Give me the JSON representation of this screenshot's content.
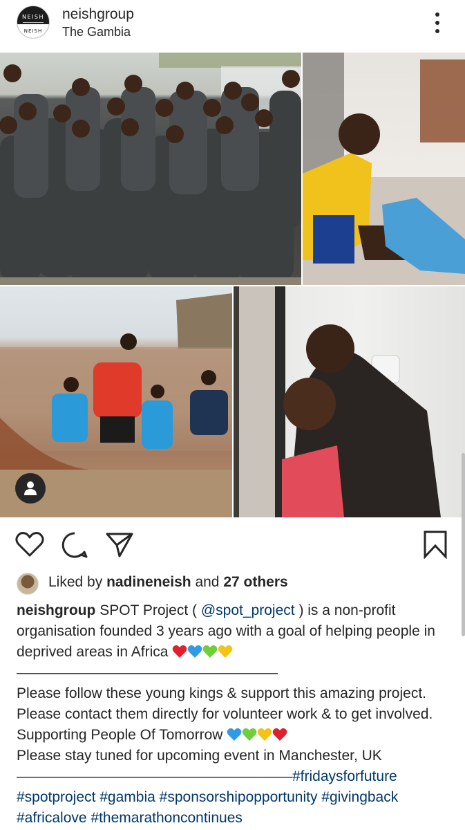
{
  "post": {
    "username": "neishgroup",
    "location": "The Gambia",
    "avatar_logo": {
      "top": "NEISH",
      "bottom": "NEISH"
    }
  },
  "icons": {
    "more": "more-vertical-icon",
    "like": "heart-outline-icon",
    "comment": "comment-bubble-icon",
    "share": "paper-plane-icon",
    "save": "bookmark-icon",
    "tag": "user-tag-icon"
  },
  "likes": {
    "prefix": "Liked by",
    "user": "nadineneish",
    "middle": "and",
    "others": "27 others"
  },
  "caption": {
    "username": "neishgroup",
    "line1_a": "SPOT Project (",
    "mention": "@spot_project",
    "line1_b": ") is a non-profit organisation founded 3 years ago with a goal of helping people in deprived areas in Africa",
    "divider1": "——————————————————",
    "para2": "Please follow these young kings & support this amazing project. Please contact them directly for volunteer work & to get involved. Supporting People Of Tomorrow",
    "para3": "Please stay tuned for upcoming event in Manchester, UK",
    "divider2": "———————————————————",
    "hashtags": [
      "#fridaysforfuture",
      "#spotproject",
      "#gambia",
      "#sponsorshipopportunity",
      "#givingback",
      "#africalove",
      "#themarathoncontinues"
    ]
  },
  "emoji_hearts": {
    "first": [
      "#e0202f",
      "#2f9be6",
      "#6fcf3a",
      "#f3c316"
    ],
    "second": [
      "#2f9be6",
      "#6fcf3a",
      "#f3c316",
      "#e0202f"
    ]
  },
  "colors": {
    "text": "#262626",
    "link": "#00376b",
    "background": "#ffffff"
  }
}
